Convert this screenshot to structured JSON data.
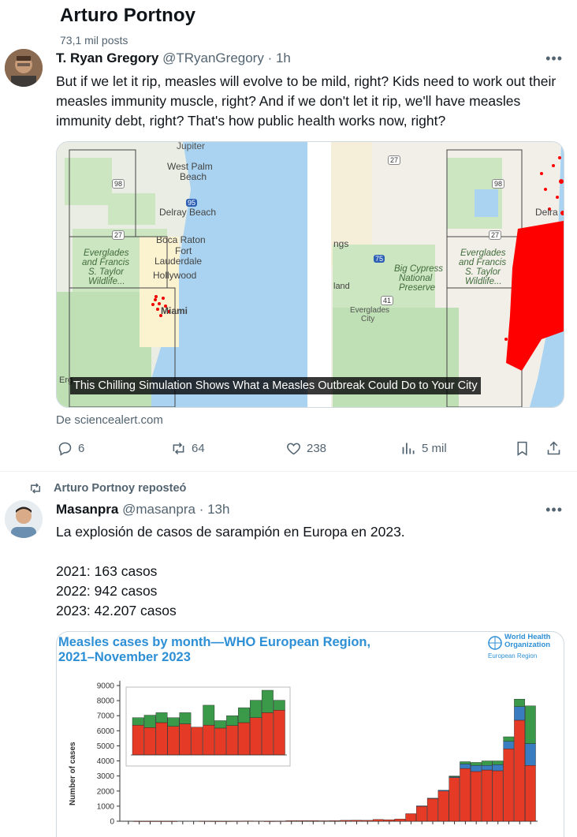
{
  "header": {
    "name": "Arturo Portnoy",
    "posts": "73,1 mil posts"
  },
  "tweet1": {
    "display_name": "T. Ryan Gregory",
    "handle": "@TRyanGregory",
    "time": "· 1h",
    "text": "But if we let it rip, measles will evolve to be mild, right? Kids need to work out their measles immunity muscle, right? And if we don't let it rip, we'll have measles immunity debt, right? That's how public health works now, right?",
    "media_caption": "This Chilling Simulation Shows What a Measles Outbreak Could Do to Your City",
    "source": "De sciencealert.com",
    "map_labels": [
      "Jupiter",
      "West Palm",
      "Beach",
      "Delray Beach",
      "Boca Raton",
      "Fort",
      "Lauderdale",
      "Hollywood",
      "Miami",
      "Everglades",
      "and Francis",
      "S. Taylor",
      "Wildlife...",
      "Big Cypress",
      "National",
      "Preserve",
      "Everglades",
      "City",
      "Everglades",
      "and Francis",
      "S. Taylor",
      "Wildlife...",
      "Delra",
      "ngs",
      "land",
      "Erg",
      "98",
      "95",
      "27",
      "75",
      "41",
      "27",
      "98",
      "27"
    ],
    "replies": "6",
    "reposts": "64",
    "likes": "238",
    "views": "5 mil"
  },
  "repost_banner": "Arturo Portnoy reposteó",
  "tweet2": {
    "display_name": "Masanpra",
    "handle": "@masanpra",
    "time": "· 13h",
    "text": "La explosión de casos de sarampión en Europa en 2023.\n\n2021: 163 casos\n2022: 942 casos\n2023: 42.207 casos",
    "chart_title_line1": "Measles cases by month—WHO European Region,",
    "chart_title_line2": "2021–November 2023",
    "who_logo_line1": "World Health",
    "who_logo_line2": "Organization",
    "who_logo_line3": "European Region"
  },
  "chart_data": {
    "type": "bar",
    "stacked": true,
    "ylabel": "Number of cases",
    "ylim": [
      0,
      9000
    ],
    "yticks": [
      0,
      1000,
      2000,
      3000,
      4000,
      5000,
      6000,
      7000,
      8000,
      9000
    ],
    "series": [
      {
        "name": "confirmed-red",
        "color": "#e53a26",
        "values": [
          0,
          5,
          5,
          5,
          5,
          0,
          0,
          10,
          5,
          5,
          10,
          20,
          15,
          5,
          10,
          40,
          40,
          40,
          30,
          40,
          60,
          70,
          60,
          120,
          100,
          150,
          500,
          1000,
          1500,
          2000,
          2900,
          3500,
          3300,
          3400,
          3350,
          4800,
          6700,
          3700
        ]
      },
      {
        "name": "blue",
        "color": "#3a7cc0",
        "values": [
          0,
          0,
          0,
          0,
          0,
          0,
          0,
          0,
          0,
          0,
          0,
          0,
          0,
          0,
          0,
          0,
          0,
          0,
          0,
          0,
          0,
          0,
          0,
          0,
          0,
          0,
          0,
          20,
          30,
          60,
          50,
          300,
          400,
          300,
          400,
          500,
          900,
          1450
        ]
      },
      {
        "name": "green",
        "color": "#3a9a4a",
        "values": [
          0,
          0,
          0,
          0,
          0,
          0,
          0,
          0,
          0,
          0,
          0,
          0,
          0,
          0,
          0,
          0,
          0,
          0,
          0,
          0,
          0,
          0,
          0,
          0,
          0,
          0,
          0,
          0,
          0,
          0,
          50,
          150,
          200,
          300,
          250,
          300,
          500,
          2500
        ]
      }
    ],
    "inset": {
      "values_red": [
        120,
        110,
        130,
        115,
        125,
        112,
        120,
        108,
        118,
        130,
        150,
        170,
        180
      ],
      "values_green": [
        30,
        50,
        40,
        35,
        45,
        0,
        80,
        30,
        40,
        60,
        70,
        90,
        40
      ]
    }
  }
}
